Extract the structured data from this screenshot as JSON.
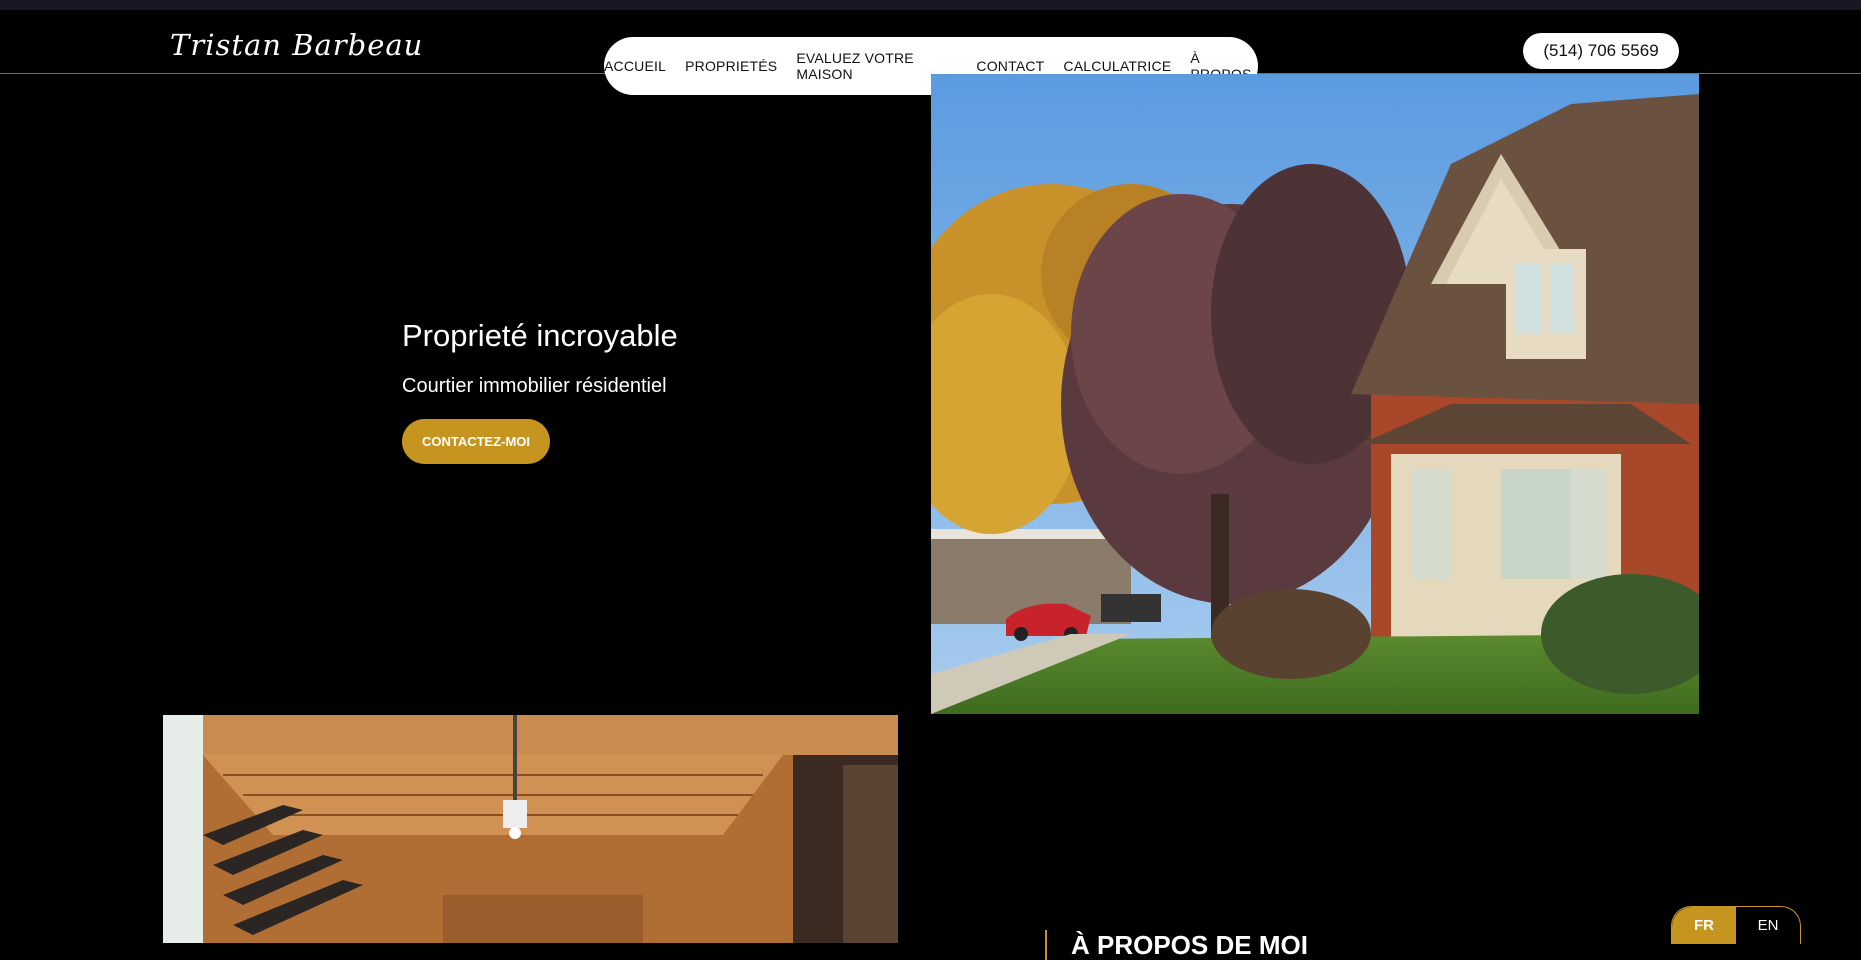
{
  "header": {
    "logo": "Tristan Barbeau",
    "phone": "(514) 706 5569",
    "nav": [
      {
        "label": "ACCUEIL"
      },
      {
        "label": "PROPRIETÉS"
      },
      {
        "label": "EVALUEZ VOTRE MAISON"
      },
      {
        "label": "CONTACT"
      },
      {
        "label": "CALCULATRICE"
      },
      {
        "label": "À PROPOS"
      }
    ]
  },
  "hero": {
    "title": "Proprieté incroyable",
    "subtitle": "Courtier immobilier résidentiel",
    "cta_label": "CONTACTEZ-MOI"
  },
  "about": {
    "heading": "À PROPOS DE MOI"
  },
  "language": {
    "fr": "FR",
    "en": "EN",
    "active": "FR"
  },
  "colors": {
    "accent": "#c59520",
    "background": "#000000"
  }
}
